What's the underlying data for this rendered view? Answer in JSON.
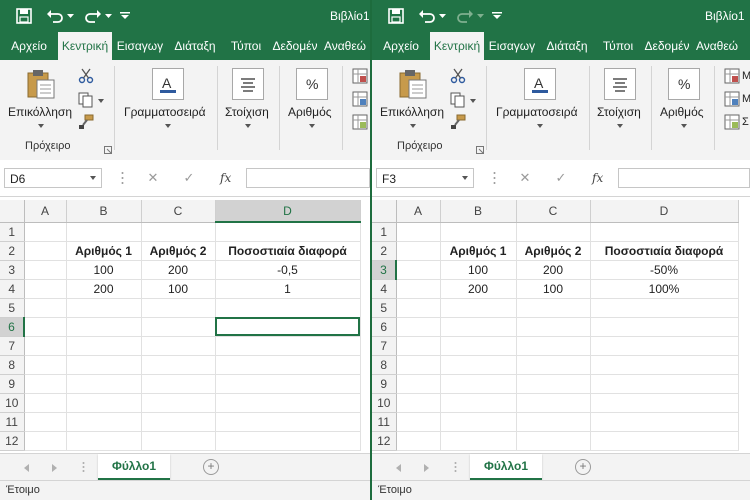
{
  "colors": {
    "accent": "#217346",
    "ribbon_bg": "#f3f3f3",
    "grid_line": "#e1e1e1"
  },
  "windows": [
    {
      "title": "Βιβλίο1",
      "tabs": [
        "Αρχείο",
        "Κεντρική",
        "Εισαγωγ",
        "Διάταξη",
        "Τύποι",
        "Δεδομέν",
        "Αναθεώ"
      ],
      "active_tab": 1,
      "ribbon": {
        "paste_label": "Επικόλληση",
        "clipboard_group": "Πρόχειρο",
        "font_label": "Γραμματοσειρά",
        "align_label": "Στοίχιση",
        "number_label": "Αριθμός",
        "styles_label": ""
      },
      "name_box": "D6",
      "fx_label": "fx",
      "columns": [
        "A",
        "B",
        "C",
        "D"
      ],
      "selected_col": "D",
      "selected_row": 6,
      "active_cell": "D6",
      "rows": [
        [
          "",
          "",
          "",
          ""
        ],
        [
          "",
          "Αριθμός 1",
          "Αριθμός 2",
          "Ποσοστιαία διαφορά"
        ],
        [
          "",
          "100",
          "200",
          "-0,5"
        ],
        [
          "",
          "200",
          "100",
          "1"
        ],
        [
          "",
          "",
          "",
          ""
        ],
        [
          "",
          "",
          "",
          ""
        ],
        [
          "",
          "",
          "",
          ""
        ],
        [
          "",
          "",
          "",
          ""
        ],
        [
          "",
          "",
          "",
          ""
        ],
        [
          "",
          "",
          "",
          ""
        ],
        [
          "",
          "",
          "",
          ""
        ],
        [
          "",
          "",
          "",
          ""
        ]
      ],
      "sheet_tab": "Φύλλο1",
      "status": "Έτοιμο"
    },
    {
      "title": "Βιβλίο1",
      "tabs": [
        "Αρχείο",
        "Κεντρική",
        "Εισαγωγ",
        "Διάταξη",
        "Τύποι",
        "Δεδομέν",
        "Αναθεώ"
      ],
      "active_tab": 1,
      "ribbon": {
        "paste_label": "Επικόλληση",
        "clipboard_group": "Πρόχειρο",
        "font_label": "Γραμματοσειρά",
        "align_label": "Στοίχιση",
        "number_label": "Αριθμός",
        "styles_label": ""
      },
      "name_box": "F3",
      "fx_label": "fx",
      "columns": [
        "A",
        "B",
        "C",
        "D"
      ],
      "selected_col": "",
      "selected_row": 3,
      "active_cell": "",
      "rows": [
        [
          "",
          "",
          "",
          ""
        ],
        [
          "",
          "Αριθμός 1",
          "Αριθμός 2",
          "Ποσοστιαία διαφορά"
        ],
        [
          "",
          "100",
          "200",
          "-50%"
        ],
        [
          "",
          "200",
          "100",
          "100%"
        ],
        [
          "",
          "",
          "",
          ""
        ],
        [
          "",
          "",
          "",
          ""
        ],
        [
          "",
          "",
          "",
          ""
        ],
        [
          "",
          "",
          "",
          ""
        ],
        [
          "",
          "",
          "",
          ""
        ],
        [
          "",
          "",
          "",
          ""
        ],
        [
          "",
          "",
          "",
          ""
        ],
        [
          "",
          "",
          "",
          ""
        ]
      ],
      "sheet_tab": "Φύλλο1",
      "status": "Έτοιμο"
    }
  ]
}
